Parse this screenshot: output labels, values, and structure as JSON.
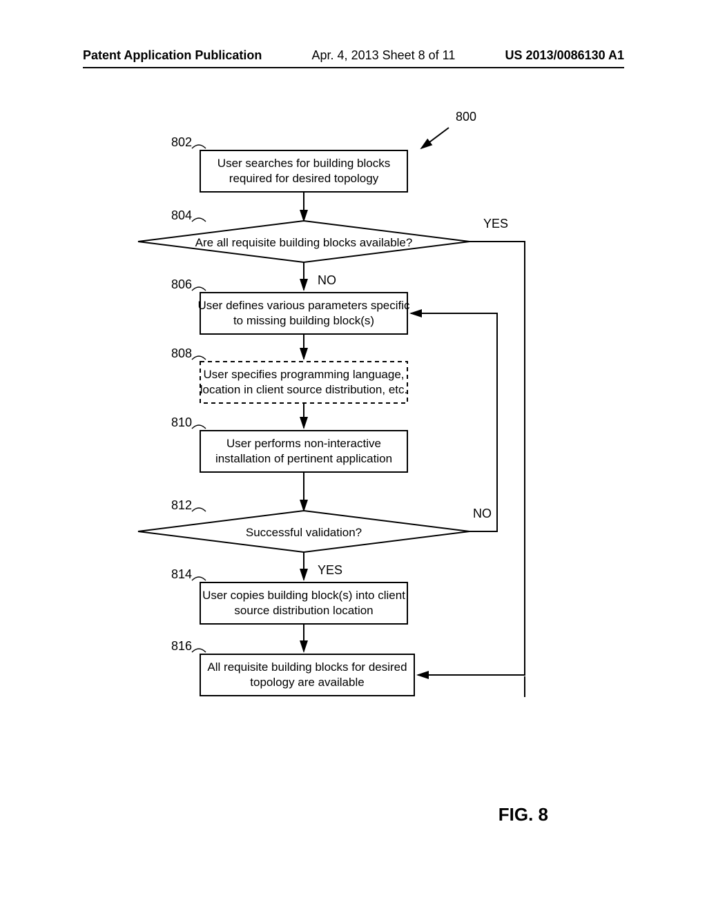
{
  "header": {
    "left": "Patent Application Publication",
    "center": "Apr. 4, 2013  Sheet 8 of 11",
    "right": "US 2013/0086130 A1"
  },
  "figure_label": "FIG. 8",
  "ref_main": "800",
  "nodes": {
    "802": {
      "num": "802",
      "line1": "User searches for building blocks",
      "line2": "required for desired topology"
    },
    "804": {
      "num": "804",
      "text": "Are all requisite building blocks available?",
      "yes": "YES",
      "no": "NO"
    },
    "806": {
      "num": "806",
      "line1": "User defines various parameters specific",
      "line2": "to missing building block(s)"
    },
    "808": {
      "num": "808",
      "line1": "User specifies programming language,",
      "line2": "location in client source distribution, etc."
    },
    "810": {
      "num": "810",
      "line1": "User performs non-interactive",
      "line2": "installation of pertinent application"
    },
    "812": {
      "num": "812",
      "text": "Successful validation?",
      "yes": "YES",
      "no": "NO"
    },
    "814": {
      "num": "814",
      "line1": "User copies building block(s) into client",
      "line2": "source distribution location"
    },
    "816": {
      "num": "816",
      "line1": "All requisite building blocks for desired",
      "line2": "topology are available"
    }
  }
}
